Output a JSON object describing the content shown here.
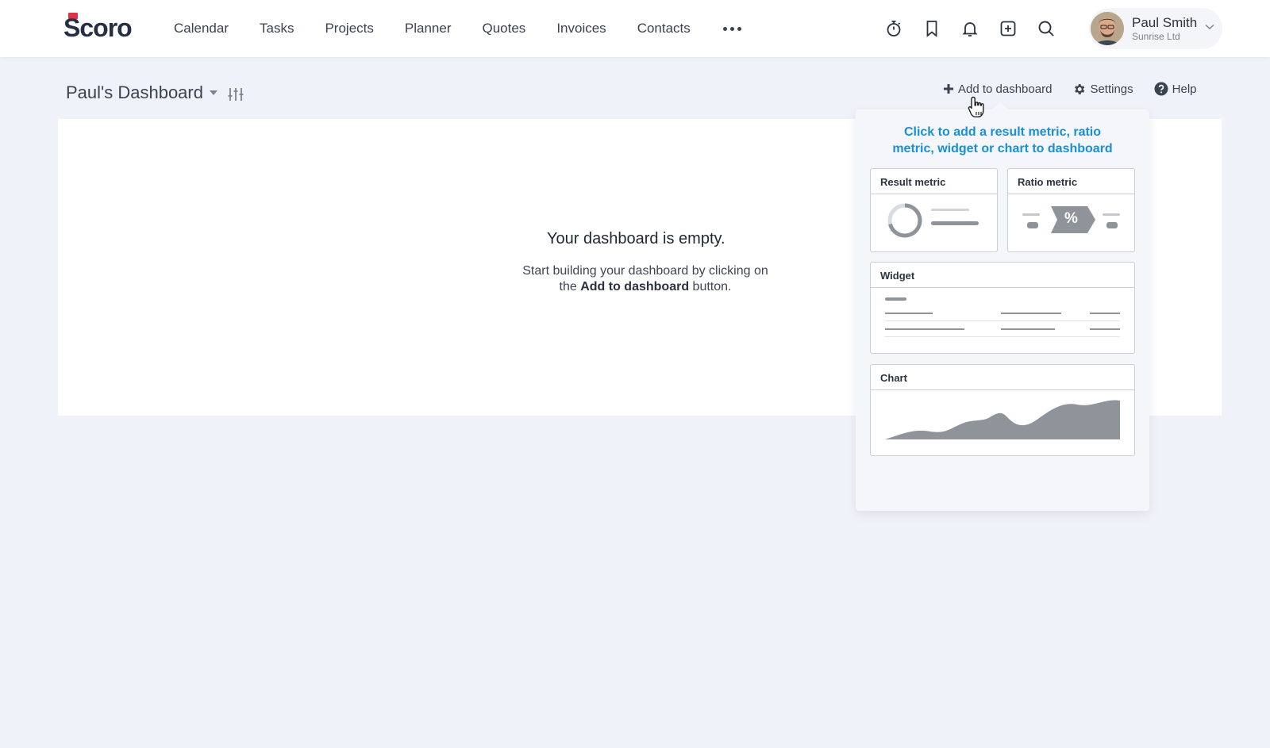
{
  "nav": {
    "logo": "Scoro",
    "items": [
      "Calendar",
      "Tasks",
      "Projects",
      "Planner",
      "Quotes",
      "Invoices",
      "Contacts"
    ],
    "icons": [
      "timer-icon",
      "bookmark-icon",
      "bell-icon",
      "add-square-icon",
      "search-icon"
    ]
  },
  "user": {
    "name": "Paul Smith",
    "company": "Sunrise Ltd"
  },
  "dashboard": {
    "title": "Paul's Dashboard",
    "actions": {
      "add": "Add to dashboard",
      "settings": "Settings",
      "help": "Help"
    },
    "empty": {
      "title": "Your dashboard is empty.",
      "desc_before": "Start building your dashboard by clicking on the ",
      "desc_bold": "Add to dashboard",
      "desc_after": " button."
    }
  },
  "add_menu": {
    "title_line1": "Click to add a result metric, ratio",
    "title_line2": "metric, widget or chart to dashboard",
    "tiles": {
      "result": "Result metric",
      "ratio": "Ratio metric",
      "ratio_symbol": "%",
      "widget": "Widget",
      "chart": "Chart"
    }
  },
  "colors": {
    "accent_blue": "#1a8fd6",
    "brand_red": "#e0334a",
    "background": "#eff2f8"
  }
}
